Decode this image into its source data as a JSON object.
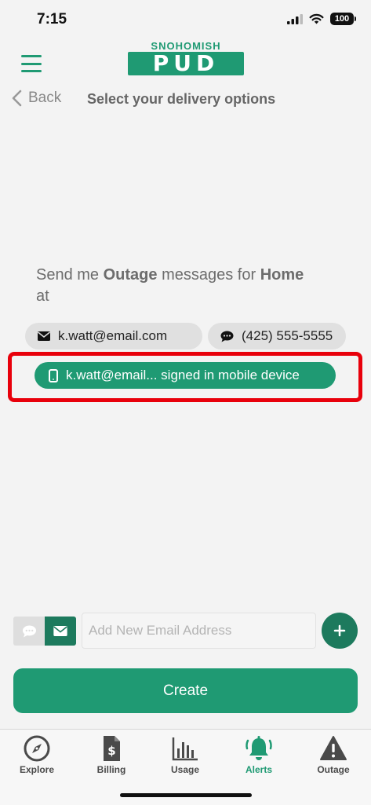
{
  "status": {
    "time": "7:15",
    "battery": "100"
  },
  "logo": {
    "top": "SNOHOMISH",
    "main": "PUD"
  },
  "nav": {
    "back_label": "Back",
    "title": "Select your delivery options"
  },
  "message": {
    "prefix": "Send me ",
    "alert_type": "Outage",
    "middle": " messages for ",
    "location": "Home",
    "suffix": "at"
  },
  "delivery": {
    "email": "k.watt@email.com",
    "phone": "(425) 555-5555",
    "device": "k.watt@email... signed in mobile device"
  },
  "compose": {
    "placeholder": "Add New Email Address",
    "create_label": "Create"
  },
  "tabs": [
    {
      "label": "Explore",
      "icon": "compass-icon"
    },
    {
      "label": "Billing",
      "icon": "bill-icon"
    },
    {
      "label": "Usage",
      "icon": "bar-chart-icon"
    },
    {
      "label": "Alerts",
      "icon": "bell-icon",
      "active": true
    },
    {
      "label": "Outage",
      "icon": "warning-icon"
    }
  ],
  "colors": {
    "brand": "#1f9a73",
    "brand_dark": "#1d7a5d",
    "highlight": "#e8000b"
  }
}
